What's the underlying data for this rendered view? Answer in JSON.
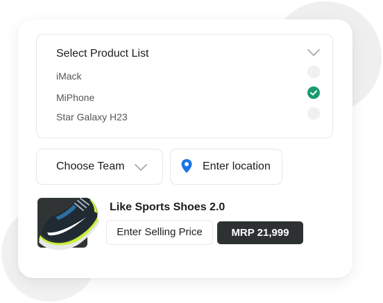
{
  "product_list": {
    "title": "Select Product List",
    "items": [
      {
        "label": "iMack",
        "checked": false
      },
      {
        "label": "MiPhone",
        "checked": true
      },
      {
        "label": "Star Galaxy H23",
        "checked": false
      }
    ]
  },
  "team": {
    "label": "Choose Team"
  },
  "location": {
    "label": "Enter location"
  },
  "product": {
    "name": "Like Sports Shoes 2.0",
    "price_placeholder": "Enter Selling Price",
    "mrp": "MRP 21,999"
  },
  "colors": {
    "accent_check": "#1a9b72",
    "pin_blue": "#1a73e8",
    "badge_bg": "#2d3132"
  },
  "icons": {
    "dropdown": "chevron-down-icon",
    "checked": "check-icon",
    "location": "map-pin-icon",
    "product_image": "sports-shoe-image"
  }
}
